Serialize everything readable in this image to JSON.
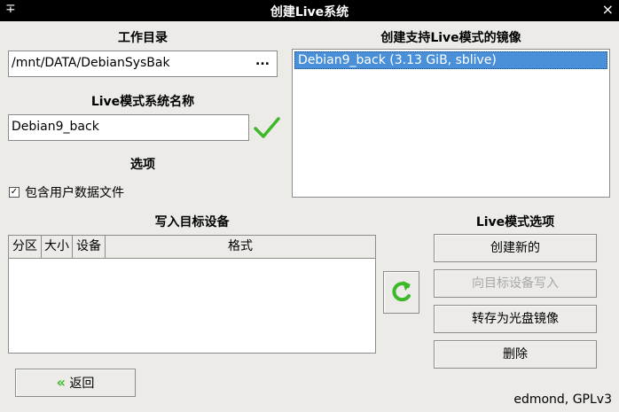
{
  "window": {
    "title": "创建Live系统",
    "pin_glyph": "∓",
    "close_glyph": "×"
  },
  "work_dir": {
    "heading": "工作目录",
    "value": "/mnt/DATA/DebianSysBak",
    "browse_label": "..."
  },
  "live_name": {
    "heading": "Live模式系统名称",
    "value": "Debian9_back",
    "valid_icon": "checkmark-icon"
  },
  "options": {
    "heading": "选项",
    "checkbox_label": "包含用户数据文件",
    "checked": true,
    "check_glyph": "✓"
  },
  "images": {
    "heading": "创建支持Live模式的镜像",
    "items": [
      "Debian9_back (3.13 GiB, sblive)"
    ]
  },
  "target": {
    "heading": "写入目标设备",
    "columns": [
      "分区",
      "大小",
      "设备",
      "格式"
    ]
  },
  "live_options": {
    "heading": "Live模式选项",
    "buttons": [
      {
        "label": "创建新的",
        "enabled": true
      },
      {
        "label": "向目标设备写入",
        "enabled": false
      },
      {
        "label": "转存为光盘镜像",
        "enabled": true
      },
      {
        "label": "删除",
        "enabled": true
      }
    ]
  },
  "back_button": {
    "label": "返回",
    "icon": "double-chevron-left-icon"
  },
  "refresh_button": {
    "icon": "refresh-icon"
  },
  "footer": {
    "text": "edmond, GPLv3"
  },
  "colors": {
    "accent_green": "#3cb829",
    "selection": "#4a90d9"
  }
}
